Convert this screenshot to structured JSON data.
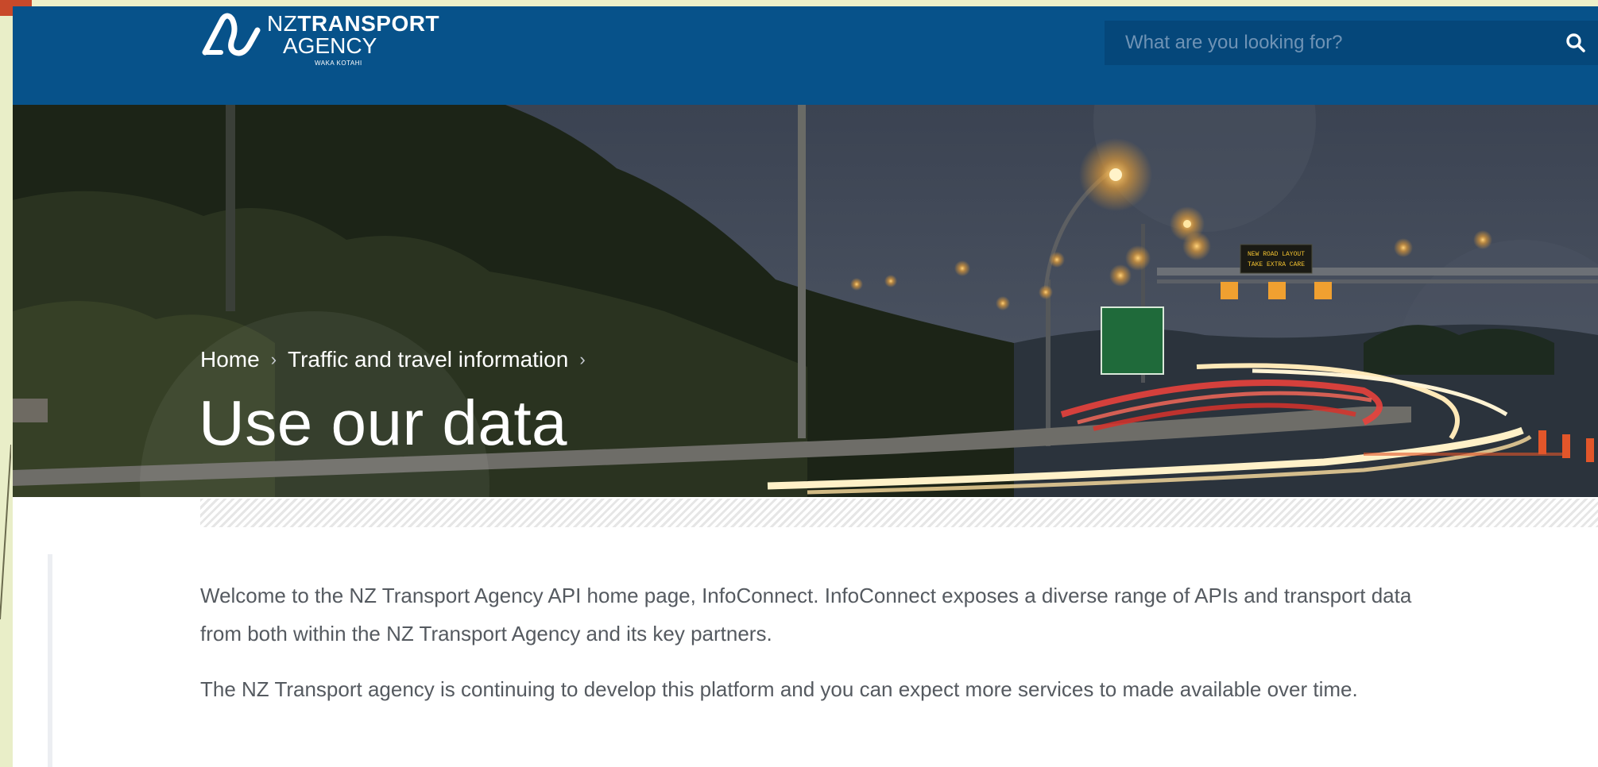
{
  "brand": {
    "logo_prefix": "NZ",
    "logo_main": "TRANSPORT",
    "logo_line2": "AGENCY",
    "logo_line3": "WAKA KOTAHI",
    "color": "#07528a"
  },
  "search": {
    "placeholder": "What are you looking for?",
    "icon": "search-icon"
  },
  "breadcrumb": {
    "items": [
      "Home",
      "Traffic and travel information"
    ],
    "separator": "›"
  },
  "page": {
    "title": "Use our data"
  },
  "content": {
    "paragraphs": [
      "Welcome to the NZ Transport Agency API home page, InfoConnect. InfoConnect  exposes a diverse range of APIs and transport data from both within the NZ Transport Agency and its key partners.",
      "The NZ Transport agency is continuing to develop this platform and you can expect more services to made available over time."
    ]
  },
  "hero_sign": {
    "line1": "NEW ROAD LAYOUT",
    "line2": "TAKE EXTRA CARE"
  }
}
